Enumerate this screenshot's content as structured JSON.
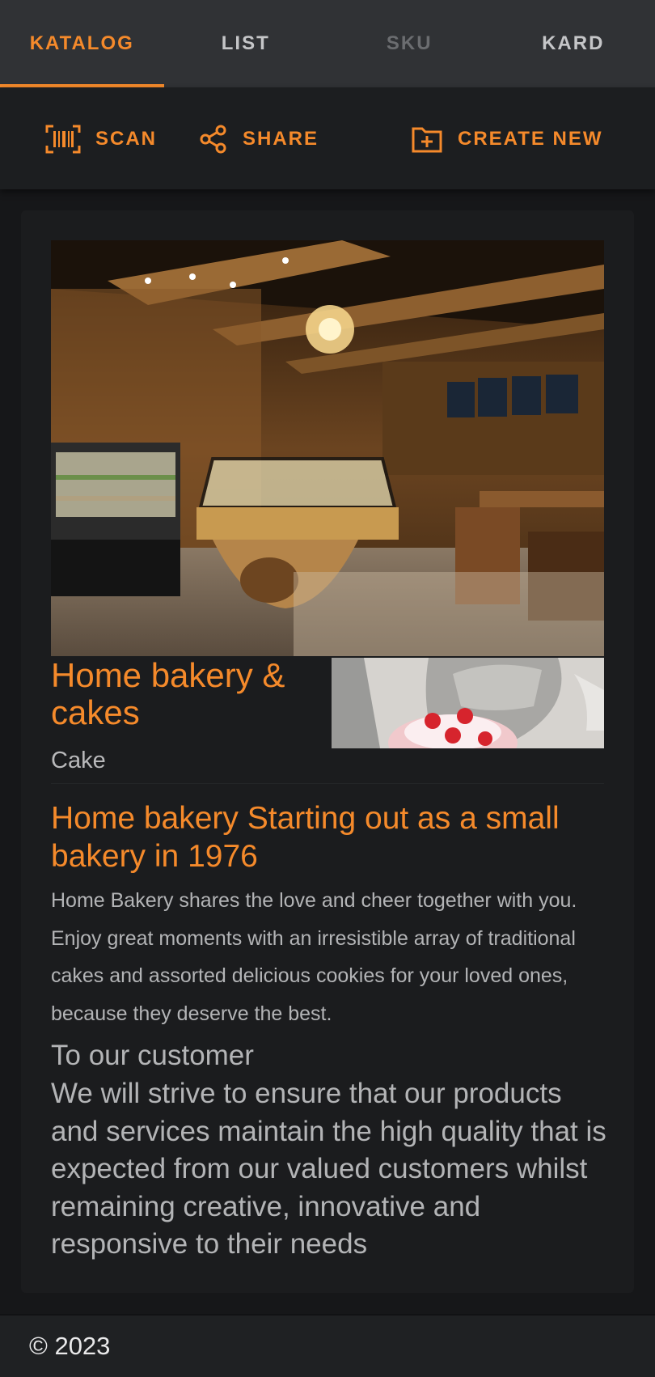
{
  "tabs": [
    {
      "label": "KATALOG",
      "state": "active"
    },
    {
      "label": "LIST",
      "state": "normal"
    },
    {
      "label": "SKU",
      "state": "disabled"
    },
    {
      "label": "KARD",
      "state": "normal"
    }
  ],
  "toolbar": {
    "scan_label": "SCAN",
    "share_label": "SHARE",
    "create_label": "CREATE NEW",
    "scan_icon": "barcode-scan-icon",
    "share_icon": "share-icon",
    "create_icon": "add-box-icon"
  },
  "item": {
    "title": "Home bakery & cakes",
    "category": "Cake",
    "headline": "Home bakery Starting out as a small bakery in 1976",
    "description": "Home Bakery shares the love and cheer together with you. Enjoy great moments with an irresistible array of traditional cakes and assorted delicious cookies for your loved ones, because they deserve the best.",
    "customer_title": "To our customer",
    "customer_body": "We will strive to ensure that our products and services maintain the high quality that is expected from our valued customers whilst remaining creative, innovative and responsive to their needs"
  },
  "footer": {
    "copyright": "© 2023"
  },
  "colors": {
    "accent": "#f58a2b",
    "background": "#161719",
    "tabbar": "#303235",
    "card": "#1b1c1e"
  }
}
